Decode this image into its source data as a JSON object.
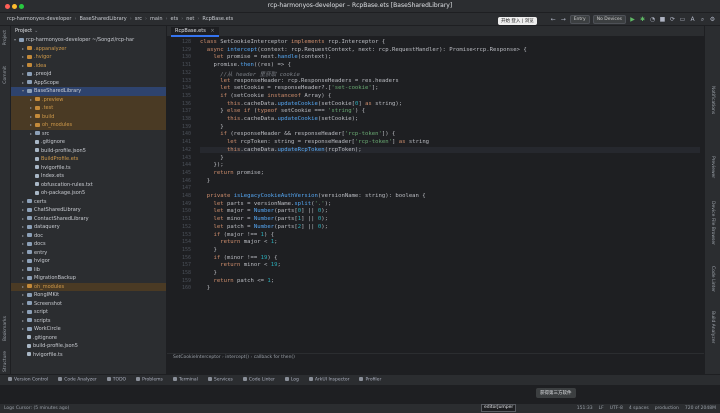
{
  "window": {
    "title": "rcp-harmonyos-developer – RcpBase.ets [BaseSharedLibrary]"
  },
  "toolbar": {
    "breadcrumbs": [
      "rcp-harmonyos-developer",
      "BaseSharedLibrary",
      "src",
      "main",
      "ets",
      "net",
      "RcpBase.ets"
    ],
    "run_config": "Entry",
    "device": "No Devices",
    "tooltip": "开始 登入 | 浏览"
  },
  "left_strip": [
    "Project",
    "Commit",
    "Bookmarks",
    "Structure"
  ],
  "right_strip": [
    "Notifications",
    "Previewer",
    "Device File Browser",
    "Code Linter",
    "Build Analyzer"
  ],
  "project": {
    "header": "Project",
    "tree": [
      {
        "label": "rcp-harmonyos-developer ~/Songzi/rcp-har",
        "depth": 0,
        "arrow": "▾",
        "kind": "folder",
        "style": ""
      },
      {
        "label": ".appanalyzer",
        "depth": 1,
        "arrow": "▸",
        "kind": "folder orange",
        "style": "orange-text"
      },
      {
        "label": ".hvigor",
        "depth": 1,
        "arrow": "▸",
        "kind": "folder orange",
        "style": "orange-text"
      },
      {
        "label": ".idea",
        "depth": 1,
        "arrow": "▸",
        "kind": "folder orange",
        "style": "orange-text"
      },
      {
        "label": ".preojd",
        "depth": 1,
        "arrow": "▸",
        "kind": "folder",
        "style": ""
      },
      {
        "label": "AppScope",
        "depth": 1,
        "arrow": "▸",
        "kind": "folder",
        "style": ""
      },
      {
        "label": "BaseSharedLibrary",
        "depth": 1,
        "arrow": "▾",
        "kind": "folder",
        "style": "sel"
      },
      {
        "label": ".preview",
        "depth": 2,
        "arrow": "▸",
        "kind": "folder orange",
        "style": "hl orange-text"
      },
      {
        "label": ".test",
        "depth": 2,
        "arrow": "▸",
        "kind": "folder orange",
        "style": "hl orange-text"
      },
      {
        "label": "build",
        "depth": 2,
        "arrow": "▸",
        "kind": "folder orange",
        "style": "hl orange-text"
      },
      {
        "label": "oh_modules",
        "depth": 2,
        "arrow": "▸",
        "kind": "folder orange",
        "style": "hl orange-text"
      },
      {
        "label": "src",
        "depth": 2,
        "arrow": "▸",
        "kind": "folder",
        "style": ""
      },
      {
        "label": ".gitignore",
        "depth": 2,
        "arrow": "",
        "kind": "file",
        "style": ""
      },
      {
        "label": "build-profile.json5",
        "depth": 2,
        "arrow": "",
        "kind": "file",
        "style": ""
      },
      {
        "label": "BuildProfile.ets",
        "depth": 2,
        "arrow": "",
        "kind": "file",
        "style": "orange-text"
      },
      {
        "label": "hvigorfile.ts",
        "depth": 2,
        "arrow": "",
        "kind": "file",
        "style": ""
      },
      {
        "label": "Index.ets",
        "depth": 2,
        "arrow": "",
        "kind": "file",
        "style": ""
      },
      {
        "label": "obfuscation-rules.txt",
        "depth": 2,
        "arrow": "",
        "kind": "file",
        "style": ""
      },
      {
        "label": "oh-package.json5",
        "depth": 2,
        "arrow": "",
        "kind": "file",
        "style": ""
      },
      {
        "label": "certs",
        "depth": 1,
        "arrow": "▸",
        "kind": "folder",
        "style": ""
      },
      {
        "label": "ChatSharedLibrary",
        "depth": 1,
        "arrow": "▸",
        "kind": "folder",
        "style": ""
      },
      {
        "label": "ContactSharedLibrary",
        "depth": 1,
        "arrow": "▸",
        "kind": "folder",
        "style": ""
      },
      {
        "label": "dataquery",
        "depth": 1,
        "arrow": "▸",
        "kind": "folder",
        "style": ""
      },
      {
        "label": "doc",
        "depth": 1,
        "arrow": "▸",
        "kind": "folder",
        "style": ""
      },
      {
        "label": "docs",
        "depth": 1,
        "arrow": "▸",
        "kind": "folder",
        "style": ""
      },
      {
        "label": "entry",
        "depth": 1,
        "arrow": "▸",
        "kind": "folder",
        "style": ""
      },
      {
        "label": "hvigor",
        "depth": 1,
        "arrow": "▸",
        "kind": "folder",
        "style": ""
      },
      {
        "label": "lib",
        "depth": 1,
        "arrow": "▸",
        "kind": "folder",
        "style": ""
      },
      {
        "label": "MigrationBackup",
        "depth": 1,
        "arrow": "▸",
        "kind": "folder",
        "style": ""
      },
      {
        "label": "oh_modules",
        "depth": 1,
        "arrow": "▸",
        "kind": "folder orange",
        "style": "hl orange-text"
      },
      {
        "label": "RongIMKit",
        "depth": 1,
        "arrow": "▸",
        "kind": "folder",
        "style": ""
      },
      {
        "label": "Screenshot",
        "depth": 1,
        "arrow": "▸",
        "kind": "folder",
        "style": ""
      },
      {
        "label": "script",
        "depth": 1,
        "arrow": "▸",
        "kind": "folder",
        "style": ""
      },
      {
        "label": "scripts",
        "depth": 1,
        "arrow": "▸",
        "kind": "folder",
        "style": ""
      },
      {
        "label": "WorkCircle",
        "depth": 1,
        "arrow": "▸",
        "kind": "folder",
        "style": ""
      },
      {
        "label": ".gitignore",
        "depth": 1,
        "arrow": "",
        "kind": "file",
        "style": ""
      },
      {
        "label": "build-profile.json5",
        "depth": 1,
        "arrow": "",
        "kind": "file",
        "style": ""
      },
      {
        "label": "hvigorfile.ts",
        "depth": 1,
        "arrow": "",
        "kind": "file",
        "style": ""
      }
    ]
  },
  "editor": {
    "tab_label": "RcpBase.ets",
    "line_numbers": [
      "128",
      "129",
      "130",
      "131",
      "132",
      "133",
      "134",
      "135",
      "136",
      "137",
      "138",
      "139",
      "140",
      "141",
      "142",
      "143",
      "144",
      "145",
      "146",
      "147",
      "148",
      "149",
      "150",
      "151",
      "152",
      "153",
      "154",
      "155",
      "156",
      "157",
      "158",
      "159",
      "160",
      "161",
      "162",
      "163",
      "164",
      "165",
      "166",
      "167",
      "168"
    ],
    "current_line_index": 14,
    "code": [
      [
        [
          "k",
          "class "
        ],
        [
          "p",
          "SetCookieInterceptor "
        ],
        [
          "k",
          "implements "
        ],
        [
          "p",
          "rcp.Interceptor {"
        ]
      ],
      [
        [
          "k",
          "  async "
        ],
        [
          "f",
          "intercept"
        ],
        [
          "p",
          "(context: rcp.RequestContext, next: rcp.RequestHandler): Promise<rcp.Response> {"
        ]
      ],
      [
        [
          "k",
          "    let "
        ],
        [
          "p",
          "promise = next."
        ],
        [
          "f",
          "handle"
        ],
        [
          "p",
          "(context);"
        ]
      ],
      [
        [
          "p",
          "    promise."
        ],
        [
          "f",
          "then"
        ],
        [
          "p",
          "((res) => {"
        ]
      ],
      [
        [
          "c",
          "      //从 header 里获取 cookie"
        ]
      ],
      [
        [
          "k",
          "      let "
        ],
        [
          "p",
          "responseHeader: rcp.ResponseHeaders = res.headers"
        ]
      ],
      [
        [
          "k",
          "      let "
        ],
        [
          "p",
          "setCookie = responseHeader?.["
        ],
        [
          "s",
          "'set-cookie'"
        ],
        [
          "p",
          "];"
        ]
      ],
      [
        [
          "k",
          "      if "
        ],
        [
          "p",
          "(setCookie "
        ],
        [
          "k",
          "instanceof "
        ],
        [
          "p",
          "Array) {"
        ]
      ],
      [
        [
          "k",
          "        this"
        ],
        [
          "p",
          ".cacheData."
        ],
        [
          "f",
          "updateCookie"
        ],
        [
          "p",
          "(setCookie["
        ],
        [
          "n",
          "0"
        ],
        [
          "p",
          "] "
        ],
        [
          "k",
          "as "
        ],
        [
          "p",
          "string);"
        ]
      ],
      [
        [
          "p",
          "      } "
        ],
        [
          "k",
          "else if "
        ],
        [
          "p",
          "("
        ],
        [
          "k",
          "typeof "
        ],
        [
          "p",
          "setCookie === "
        ],
        [
          "s",
          "'string'"
        ],
        [
          "p",
          ") {"
        ]
      ],
      [
        [
          "k",
          "        this"
        ],
        [
          "p",
          ".cacheData."
        ],
        [
          "f",
          "updateCookie"
        ],
        [
          "p",
          "(setCookie);"
        ]
      ],
      [
        [
          "p",
          "      }"
        ]
      ],
      [
        [
          "k",
          "      if "
        ],
        [
          "p",
          "(responseHeader && responseHeader["
        ],
        [
          "s",
          "'rcp-token'"
        ],
        [
          "p",
          "]) {"
        ]
      ],
      [
        [
          "k",
          "        let "
        ],
        [
          "p",
          "rcpToken: string = responseHeader["
        ],
        [
          "s",
          "'rcp-token'"
        ],
        [
          "p",
          "] "
        ],
        [
          "k",
          "as "
        ],
        [
          "p",
          "string"
        ]
      ],
      [
        [
          "k",
          "        this"
        ],
        [
          "p",
          ".cacheData."
        ],
        [
          "f",
          "updateRcpToken"
        ],
        [
          "p",
          "(rcpToken);"
        ]
      ],
      [
        [
          "p",
          "      }"
        ]
      ],
      [
        [
          "p",
          "    });"
        ]
      ],
      [
        [
          "k",
          "    return "
        ],
        [
          "p",
          "promise;"
        ]
      ],
      [
        [
          "p",
          "  }"
        ]
      ],
      [
        [
          "p",
          ""
        ]
      ],
      [
        [
          "k",
          "  private "
        ],
        [
          "f",
          "isLegacyCookieAuthVersion"
        ],
        [
          "p",
          "(versionName: string): boolean {"
        ]
      ],
      [
        [
          "k",
          "    let "
        ],
        [
          "p",
          "parts = versionName."
        ],
        [
          "f",
          "split"
        ],
        [
          "p",
          "("
        ],
        [
          "s",
          "'.'"
        ],
        [
          "p",
          ");"
        ]
      ],
      [
        [
          "k",
          "    let "
        ],
        [
          "p",
          "major = "
        ],
        [
          "f",
          "Number"
        ],
        [
          "p",
          "(parts["
        ],
        [
          "n",
          "0"
        ],
        [
          "p",
          "] || "
        ],
        [
          "n",
          "0"
        ],
        [
          "p",
          ");"
        ]
      ],
      [
        [
          "k",
          "    let "
        ],
        [
          "p",
          "minor = "
        ],
        [
          "f",
          "Number"
        ],
        [
          "p",
          "(parts["
        ],
        [
          "n",
          "1"
        ],
        [
          "p",
          "] || "
        ],
        [
          "n",
          "0"
        ],
        [
          "p",
          ");"
        ]
      ],
      [
        [
          "k",
          "    let "
        ],
        [
          "p",
          "patch = "
        ],
        [
          "f",
          "Number"
        ],
        [
          "p",
          "(parts["
        ],
        [
          "n",
          "2"
        ],
        [
          "p",
          "] || "
        ],
        [
          "n",
          "0"
        ],
        [
          "p",
          ");"
        ]
      ],
      [
        [
          "k",
          "    if "
        ],
        [
          "p",
          "(major !== "
        ],
        [
          "n",
          "1"
        ],
        [
          "p",
          ") {"
        ]
      ],
      [
        [
          "k",
          "      return "
        ],
        [
          "p",
          "major < "
        ],
        [
          "n",
          "1"
        ],
        [
          "p",
          ";"
        ]
      ],
      [
        [
          "p",
          "    }"
        ]
      ],
      [
        [
          "k",
          "    if "
        ],
        [
          "p",
          "(minor !== "
        ],
        [
          "n",
          "19"
        ],
        [
          "p",
          ") {"
        ]
      ],
      [
        [
          "k",
          "      return "
        ],
        [
          "p",
          "minor < "
        ],
        [
          "n",
          "19"
        ],
        [
          "p",
          ";"
        ]
      ],
      [
        [
          "p",
          "    }"
        ]
      ],
      [
        [
          "k",
          "    return "
        ],
        [
          "p",
          "patch <= "
        ],
        [
          "n",
          "1"
        ],
        [
          "p",
          ";"
        ]
      ],
      [
        [
          "p",
          "  }"
        ]
      ]
    ],
    "breadcrumb": [
      "SetCookieInterceptor",
      "intercept()",
      "callback for then()"
    ]
  },
  "toast": "获得第三方软件",
  "tool_windows": [
    "Version Control",
    "Code Analyzer",
    "TODO",
    "Problems",
    "Terminal",
    "Services",
    "Code Linter",
    "Log",
    "ArkUI Inspector",
    "Profiler"
  ],
  "status": {
    "left": "Logs Cursor: (5 minutes ago)",
    "ime": "editorJumper",
    "right": [
      "151:33",
      "LF",
      "UTF-8",
      "4 spaces",
      "production",
      "720 of 2048M"
    ]
  }
}
